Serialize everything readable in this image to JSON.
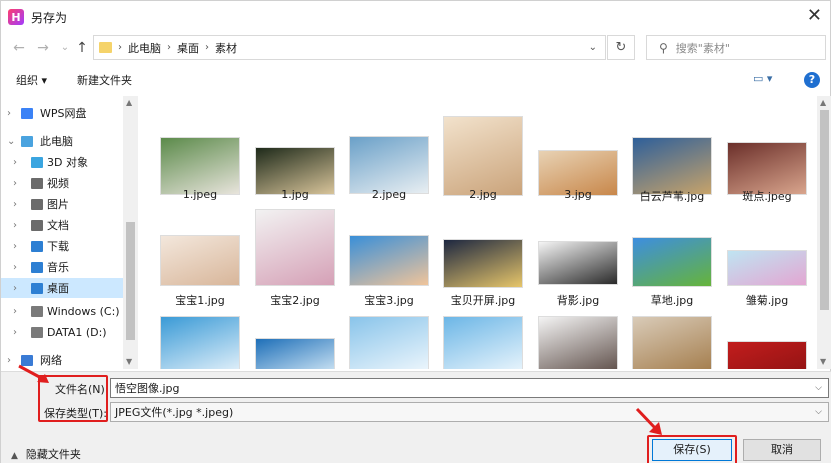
{
  "window": {
    "title": "另存为",
    "logo_letter": "H",
    "close_glyph": "✕"
  },
  "address": {
    "back": "←",
    "forward": "→",
    "recent": "⌄",
    "up": "↑",
    "crumbs": [
      "此电脑",
      "桌面",
      "素材"
    ],
    "crumb_sep": "›",
    "dropdown": "⌄",
    "refresh": "↻",
    "search_placeholder": "搜索\"素材\""
  },
  "toolbar": {
    "organize": "组织 ▾",
    "new_folder": "新建文件夹",
    "view": "▭ ▾",
    "help": "?"
  },
  "nav": {
    "items": [
      {
        "label": "WPS网盘",
        "icon": "cloud-icon",
        "color": "#3b82f6"
      },
      {
        "label": "此电脑",
        "icon": "computer-icon",
        "color": "#4aa3df"
      },
      {
        "label": "3D 对象",
        "icon": "cube-icon",
        "color": "#3aa5e0"
      },
      {
        "label": "视频",
        "icon": "video-icon",
        "color": "#6b6b6b"
      },
      {
        "label": "图片",
        "icon": "picture-icon",
        "color": "#6b6b6b"
      },
      {
        "label": "文档",
        "icon": "document-icon",
        "color": "#6b6b6b"
      },
      {
        "label": "下载",
        "icon": "download-icon",
        "color": "#2d7fd3"
      },
      {
        "label": "音乐",
        "icon": "music-icon",
        "color": "#2d7fd3"
      },
      {
        "label": "桌面",
        "icon": "desktop-icon",
        "color": "#2d7fd3"
      },
      {
        "label": "Windows (C:)",
        "icon": "drive-icon",
        "color": "#7a7a7a"
      },
      {
        "label": "DATA1 (D:)",
        "icon": "drive-icon",
        "color": "#7a7a7a"
      },
      {
        "label": "网络",
        "icon": "network-icon",
        "color": "#3a7bd5"
      }
    ]
  },
  "files": [
    {
      "label": "1.jpeg",
      "c1": "#5b8a4a",
      "c2": "#e8e4dc"
    },
    {
      "label": "1.jpg",
      "c1": "#1e2a1a",
      "c2": "#d8c49a"
    },
    {
      "label": "2.jpeg",
      "c1": "#6aa0c8",
      "c2": "#e8eef2"
    },
    {
      "label": "2.jpg",
      "c1": "#f2e2cc",
      "c2": "#caa37a"
    },
    {
      "label": "3.jpg",
      "c1": "#e8d2b4",
      "c2": "#c8874a"
    },
    {
      "label": "白云芦苇.jpg",
      "c1": "#2e5f9a",
      "c2": "#c7a36a"
    },
    {
      "label": "斑点.jpeg",
      "c1": "#6b2f2a",
      "c2": "#d9a58d"
    },
    {
      "label": "宝宝1.jpg",
      "c1": "#f3e7dc",
      "c2": "#d8b69a"
    },
    {
      "label": "宝宝2.jpg",
      "c1": "#f2f2f2",
      "c2": "#d5a0b6"
    },
    {
      "label": "宝宝3.jpg",
      "c1": "#3a8fd8",
      "c2": "#f0c49a"
    },
    {
      "label": "宝贝开屏.jpg",
      "c1": "#1d2740",
      "c2": "#e7c66a"
    },
    {
      "label": "背影.jpg",
      "c1": "#f5f5f5",
      "c2": "#2a2a2a"
    },
    {
      "label": "草地.jpg",
      "c1": "#3d8ee0",
      "c2": "#66b43a"
    },
    {
      "label": "雏菊.jpg",
      "c1": "#bfe4f2",
      "c2": "#e3a6d2"
    },
    {
      "label": "",
      "c1": "#3a9ad6",
      "c2": "#e8f3fb"
    },
    {
      "label": "",
      "c1": "#1e6fb8",
      "c2": "#d9ecf8"
    },
    {
      "label": "",
      "c1": "#89c4ea",
      "c2": "#f1f8fd"
    },
    {
      "label": "",
      "c1": "#6cb6e6",
      "c2": "#eef7fd"
    },
    {
      "label": "",
      "c1": "#f4f4f4",
      "c2": "#5a4a44"
    },
    {
      "label": "",
      "c1": "#d9cbb8",
      "c2": "#a27a48"
    },
    {
      "label": "",
      "c1": "#c21d1d",
      "c2": "#8c1212"
    }
  ],
  "form": {
    "filename_label": "文件名(N):",
    "filename_value": "悟空图像.jpg",
    "filetype_label": "保存类型(T):",
    "filetype_value": "JPEG文件(*.jpg *.jpeg)",
    "save": "保存(S)",
    "cancel": "取消",
    "hide_folders": "隐藏文件夹"
  },
  "colors": {
    "highlight": "#e01e1e",
    "selection": "#cce8ff",
    "accent": "#0078d7"
  }
}
